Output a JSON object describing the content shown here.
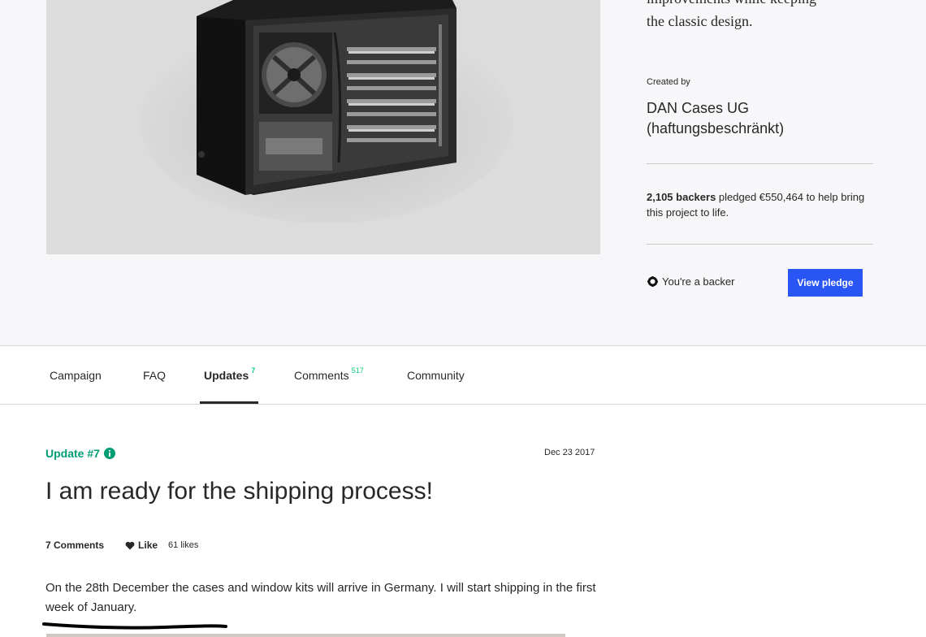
{
  "hero": {
    "blurb_cut": "improvements while keeping",
    "blurb": "the classic design.",
    "created_by_label": "Created by",
    "creator_name": "DAN Cases UG (haftungsbeschränkt)",
    "backers_count": "2,105 backers",
    "backers_rest": " pledged €550,464 to help bring this project to life.",
    "backer_status": "You're a backer",
    "view_pledge_label": "View pledge"
  },
  "tabs": {
    "campaign": "Campaign",
    "faq": "FAQ",
    "updates": "Updates",
    "updates_count": "7",
    "comments": "Comments",
    "comments_count": "517",
    "community": "Community"
  },
  "update": {
    "label": "Update #7",
    "date": "Dec 23 2017",
    "title": "I am ready for the shipping process!",
    "comments_link": "7 Comments",
    "like_label": "Like",
    "likes_count": "61 likes",
    "body": "On the 28th December the cases and window kits will arrive in Germany. I will start shipping in the first week of January."
  },
  "colors": {
    "accent_green": "#009e74",
    "count_green": "#05ce78",
    "button_blue": "#2a55f5",
    "hero_bg": "#f7f7f9"
  },
  "icons": {
    "backer": "backer-badge-icon",
    "info": "info-icon",
    "like": "heart-icon"
  }
}
